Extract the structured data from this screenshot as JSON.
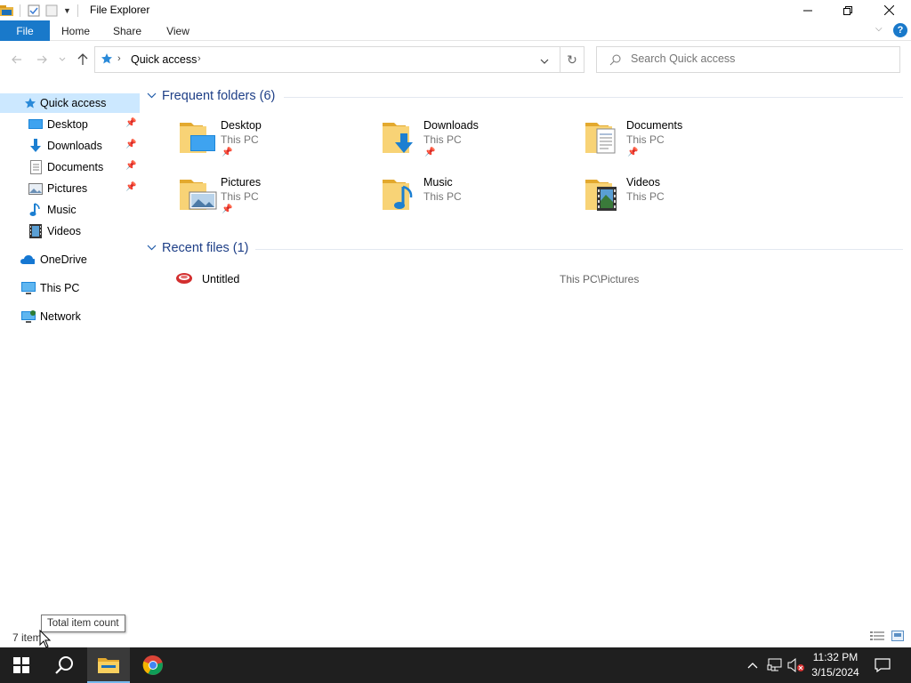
{
  "window": {
    "title": "File Explorer"
  },
  "ribbon": {
    "tabs": [
      {
        "label": "File"
      },
      {
        "label": "Home"
      },
      {
        "label": "Share"
      },
      {
        "label": "View"
      }
    ]
  },
  "address": {
    "path": "Quick access",
    "search_placeholder": "Search Quick access"
  },
  "nav": {
    "quick_access": "Quick access",
    "items": [
      {
        "label": "Desktop",
        "icon": "desktop-icon",
        "pinned": true
      },
      {
        "label": "Downloads",
        "icon": "downloads-icon",
        "pinned": true
      },
      {
        "label": "Documents",
        "icon": "documents-icon",
        "pinned": true
      },
      {
        "label": "Pictures",
        "icon": "pictures-icon",
        "pinned": true
      },
      {
        "label": "Music",
        "icon": "music-icon",
        "pinned": false
      },
      {
        "label": "Videos",
        "icon": "videos-icon",
        "pinned": false
      }
    ],
    "onedrive": "OneDrive",
    "this_pc": "This PC",
    "network": "Network"
  },
  "frequent": {
    "header": "Frequent folders (6)",
    "folders": [
      {
        "name": "Desktop",
        "location": "This PC",
        "pinned": true,
        "overlay": "desktop"
      },
      {
        "name": "Downloads",
        "location": "This PC",
        "pinned": true,
        "overlay": "download"
      },
      {
        "name": "Documents",
        "location": "This PC",
        "pinned": true,
        "overlay": "document"
      },
      {
        "name": "Pictures",
        "location": "This PC",
        "pinned": true,
        "overlay": "picture"
      },
      {
        "name": "Music",
        "location": "This PC",
        "pinned": false,
        "overlay": "music"
      },
      {
        "name": "Videos",
        "location": "This PC",
        "pinned": false,
        "overlay": "video"
      }
    ]
  },
  "recent": {
    "header": "Recent files (1)",
    "files": [
      {
        "name": "Untitled",
        "path": "This PC\\Pictures"
      }
    ]
  },
  "status": {
    "item_count": "7 items",
    "tooltip": "Total item count"
  },
  "taskbar": {
    "time": "11:32 PM",
    "date": "3/15/2024"
  },
  "colors": {
    "accent": "#1979ca",
    "selection": "#cce8ff",
    "group_header": "#1e3f87",
    "taskbar": "#1f1f1f"
  }
}
